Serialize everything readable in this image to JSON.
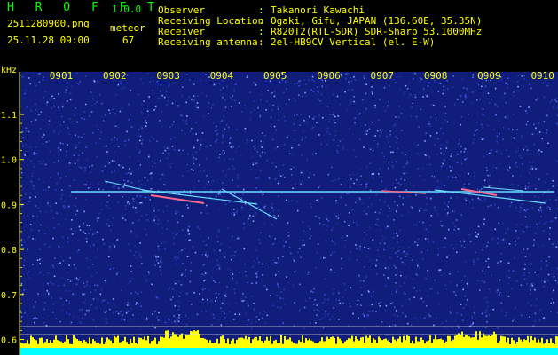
{
  "header": {
    "app_name": "H R O F F T",
    "version": "1.0.0",
    "filename": "2511280900.png",
    "timestamp": "25.11.28 09:00",
    "meteor_label": "meteor",
    "meteor_count": "67"
  },
  "info": [
    {
      "label": "Observer",
      "value": "Takanori Kawachi"
    },
    {
      "label": "Receiving Location",
      "value": "Ogaki, Gifu, JAPAN (136.60E, 35.35N)"
    },
    {
      "label": "Receiver",
      "value": "R820T2(RTL-SDR) SDR-Sharp 53.1000MHz"
    },
    {
      "label": "Receiving antenna",
      "value": "2el-HB9CV Vertical (el. E-W)"
    }
  ],
  "axis": {
    "y_unit": "kHz",
    "y_ticks": [
      "1.1",
      "1.0",
      "0.9",
      "0.8",
      "0.7",
      "0.6"
    ],
    "time_ticks": [
      "0901",
      "0902",
      "0903",
      "0904",
      "0905",
      "0906",
      "0907",
      "0908",
      "0909",
      "0910"
    ]
  },
  "colors": {
    "background": "#000000",
    "label": "#ffff00",
    "title": "#00ff00",
    "noise": "#1a2a9a",
    "carrier": "#66ddff",
    "meteor": "#ff6688",
    "level_bar": "#ffff00",
    "level_base": "#00ffff"
  }
}
